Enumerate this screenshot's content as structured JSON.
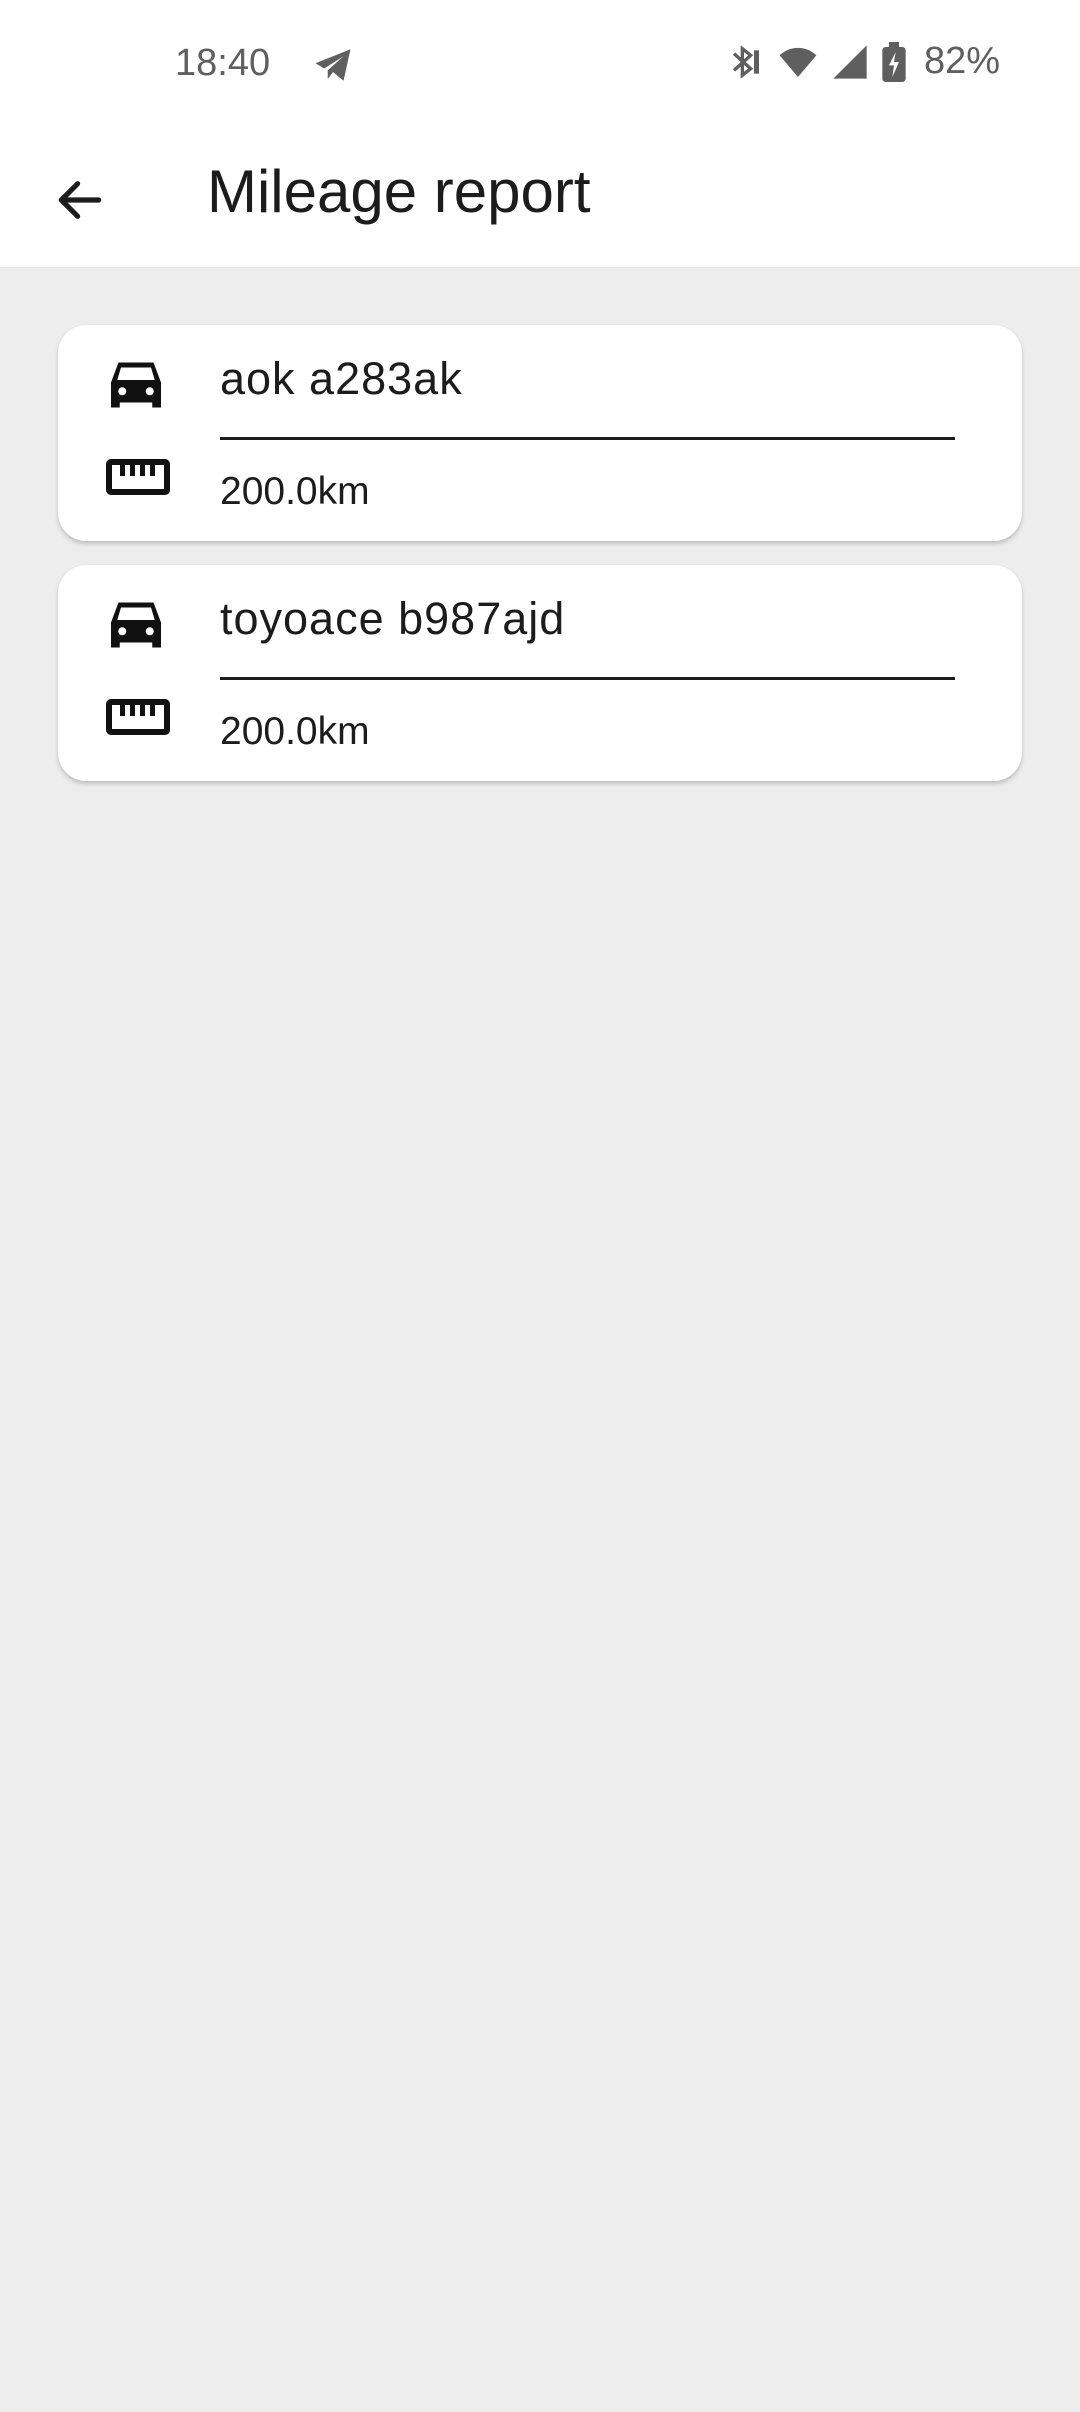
{
  "status_bar": {
    "time": "18:40",
    "battery": "82%",
    "icons": [
      "telegram-icon",
      "bluetooth-icon",
      "wifi-icon",
      "signal-icon",
      "battery-charging-icon"
    ]
  },
  "app_bar": {
    "title": "Mileage report",
    "back_icon": "arrow-back-icon"
  },
  "vehicles": [
    {
      "name": "aok a283ak",
      "mileage": "200.0km",
      "icon": "car-icon",
      "mileage_icon": "ruler-icon"
    },
    {
      "name": "toyoace b987ajd",
      "mileage": "200.0km",
      "icon": "car-icon",
      "mileage_icon": "ruler-icon"
    }
  ],
  "colors": {
    "background": "#ededed",
    "surface": "#ffffff",
    "text": "#1c1c1c",
    "status_text": "#5f5f5f"
  }
}
